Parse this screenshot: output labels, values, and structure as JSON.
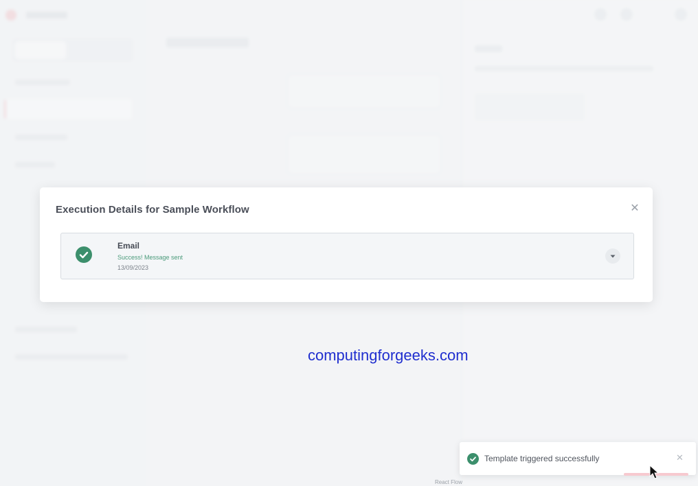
{
  "modal": {
    "title": "Execution Details for Sample Workflow",
    "close_icon": "close-icon",
    "steps": [
      {
        "name": "Email",
        "status": "Success! Message sent",
        "date": "13/09/2023",
        "icon": "check-circle-icon",
        "toggle_icon": "chevron-down-icon"
      }
    ]
  },
  "watermark": "computingforgeeks.com",
  "toast": {
    "message": "Template triggered successfully",
    "icon": "check-circle-icon",
    "close_icon": "close-icon"
  },
  "footer": {
    "brand": "React Flow"
  },
  "colors": {
    "success": "#3c8f6c",
    "success_text": "#4a9a7a",
    "watermark": "#1f2ecf",
    "accent": "#f7c9cf"
  }
}
